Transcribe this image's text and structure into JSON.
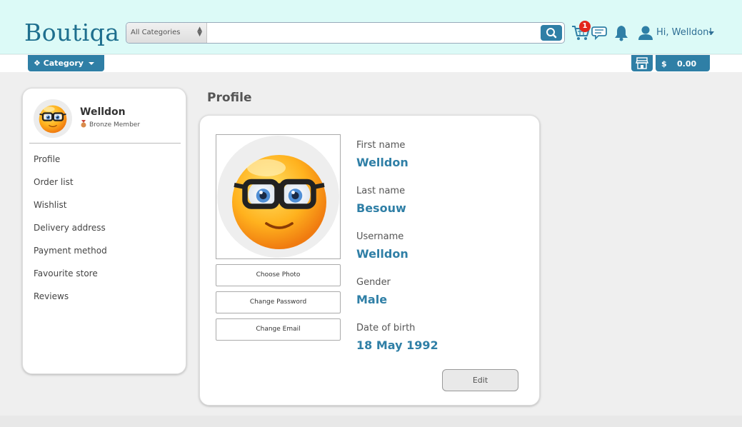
{
  "header": {
    "logo": "Boutiqa",
    "search": {
      "category": "All Categories",
      "placeholder": "",
      "value": ""
    },
    "cart_count": "1",
    "greeting": "Hi, Welldon!",
    "icons": [
      "search-icon",
      "cart-icon",
      "chat-icon",
      "bell-icon",
      "user-icon"
    ]
  },
  "subbar": {
    "category_label": "❖ Category",
    "currency": "$",
    "balance": "0.00"
  },
  "sidebar": {
    "name": "Welldon",
    "membership": "Bronze Member",
    "menu": [
      "Profile",
      "Order list",
      "Wishlist",
      "Delivery address",
      "Payment method",
      "Favourite store",
      "Reviews"
    ]
  },
  "profile": {
    "title": "Profile",
    "buttons": {
      "choose_photo": "Choose Photo",
      "change_password": "Change Password",
      "change_email": "Change Email",
      "edit": "Edit"
    },
    "fields": [
      {
        "label": "First name",
        "value": "Welldon"
      },
      {
        "label": "Last name",
        "value": "Besouw"
      },
      {
        "label": "Username",
        "value": "Welldon"
      },
      {
        "label": "Gender",
        "value": "Male"
      },
      {
        "label": "Date of birth",
        "value": "18 May 1992"
      }
    ]
  },
  "colors": {
    "accent": "#2f7fa6",
    "header_bg": "#dcfaf7",
    "page_bg": "#efefef",
    "badge": "#e3261c"
  }
}
